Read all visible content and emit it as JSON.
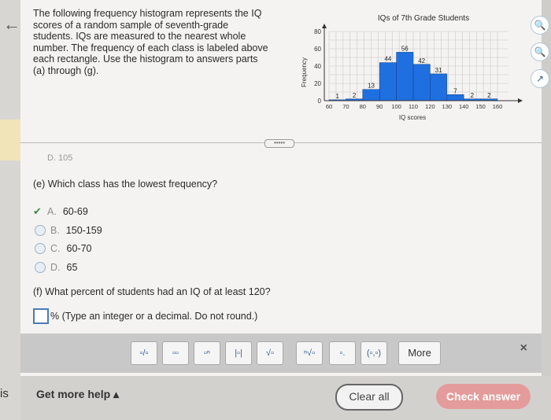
{
  "nav": {
    "back_icon": "left-arrow-icon"
  },
  "left_fragment": "is",
  "intro": "The following frequency histogram represents the IQ scores of a random sample of seventh-grade students. IQs are measured to the nearest whole number. The frequency of each class is labeled above each rectangle. Use the histogram to answers parts (a) through (g).",
  "previous_answer": "D.  105",
  "question_e": {
    "prompt": "(e) Which class has the lowest frequency?",
    "options": [
      {
        "letter": "A.",
        "text": "60-69",
        "selected": true
      },
      {
        "letter": "B.",
        "text": "150-159",
        "selected": false
      },
      {
        "letter": "C.",
        "text": "60-70",
        "selected": false
      },
      {
        "letter": "D.",
        "text": "65",
        "selected": false
      }
    ]
  },
  "question_f": {
    "prompt": "(f) What percent of students had an IQ of at least 120?",
    "suffix": "% (Type an integer or a decimal. Do not round.)"
  },
  "toolbar": {
    "buttons": [
      "frac",
      "mixed",
      "exp",
      "abs",
      "sqrt",
      "nroot",
      "dec",
      "(a,b)"
    ],
    "more_label": "More",
    "close_label": "×"
  },
  "footer": {
    "help_label": "Get more help ▴",
    "clear_label": "Clear all",
    "check_label": "Check answer"
  },
  "chart_data": {
    "type": "bar",
    "title": "IQs of 7th Grade Students",
    "xlabel": "IQ scores",
    "ylabel": "Frequency",
    "x_ticks": [
      "60",
      "70",
      "80",
      "90",
      "100",
      "110",
      "120",
      "130",
      "140",
      "150",
      "160"
    ],
    "y_ticks": [
      "0",
      "20",
      "40",
      "60",
      "80"
    ],
    "ylim": [
      0,
      80
    ],
    "bins": [
      {
        "start": 60,
        "end": 70,
        "value": 1
      },
      {
        "start": 70,
        "end": 80,
        "value": 2
      },
      {
        "start": 80,
        "end": 90,
        "value": 13
      },
      {
        "start": 90,
        "end": 100,
        "value": 44
      },
      {
        "start": 100,
        "end": 110,
        "value": 56
      },
      {
        "start": 110,
        "end": 120,
        "value": 42
      },
      {
        "start": 120,
        "end": 130,
        "value": 31
      },
      {
        "start": 130,
        "end": 140,
        "value": 7
      },
      {
        "start": 140,
        "end": 150,
        "value": 2
      },
      {
        "start": 150,
        "end": 160,
        "value": 2
      }
    ],
    "grid": true,
    "bar_color": "#1f6fe0"
  }
}
